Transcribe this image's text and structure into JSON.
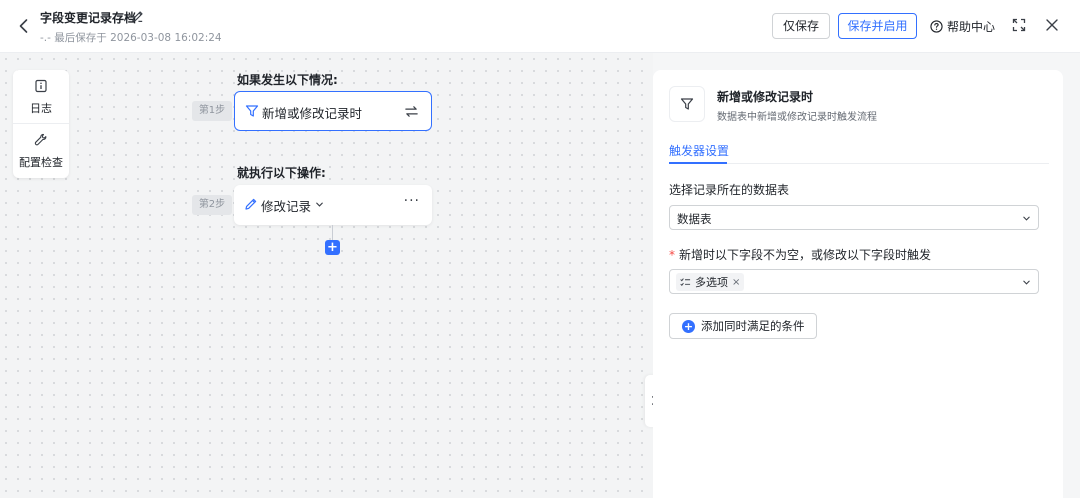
{
  "header": {
    "title": "字段变更记录存档",
    "subtitle": "-.- 最后保存于 2026-03-08 16:02:24",
    "save_only_label": "仅保存",
    "save_enable_label": "保存并启用",
    "help_label": "帮助中心"
  },
  "toolbar": {
    "log_label": "日志",
    "config_check_label": "配置检查"
  },
  "flow": {
    "trigger_section_title": "如果发生以下情况:",
    "step1_badge": "第1步",
    "trigger_node_label": "新增或修改记录时",
    "action_section_title": "就执行以下操作:",
    "step2_badge": "第2步",
    "action_node_label": "修改记录",
    "action_more": "···",
    "add_node_symbol": "+"
  },
  "panel": {
    "title": "新增或修改记录时",
    "description": "数据表中新增或修改记录时触发流程",
    "tab_label": "触发器设置",
    "table_field_label": "选择记录所在的数据表",
    "table_value": "数据表",
    "trigger_field_label": "新增时以下字段不为空，或修改以下字段时触发",
    "required_mark": "*",
    "selected_field_tag": "多选项",
    "tag_remove": "×",
    "add_condition_label": "添加同时满足的条件",
    "add_condition_symbol": "+"
  },
  "colors": {
    "accent": "#3370ff",
    "required": "#f54a45",
    "canvas_bg": "#f3f4f5"
  },
  "icons": [
    "back-arrow-icon",
    "edit-pencil-icon",
    "help-circle-icon",
    "expand-icon",
    "close-icon",
    "log-info-icon",
    "wrench-icon",
    "filter-icon",
    "swap-icon",
    "pencil-icon",
    "chevron-down-icon",
    "chevron-right-icon",
    "multi-select-icon"
  ]
}
